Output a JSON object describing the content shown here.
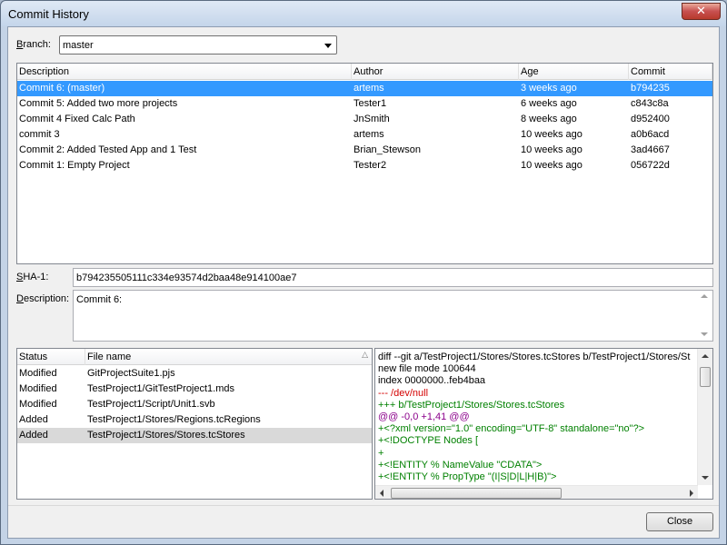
{
  "window": {
    "title": "Commit History",
    "close_glyph": "✕"
  },
  "branch": {
    "label_prefix": "",
    "label_accel": "B",
    "label_rest": "ranch:",
    "value": "master"
  },
  "commits": {
    "columns": [
      "Description",
      "Author",
      "Age",
      "Commit"
    ],
    "rows": [
      {
        "description": "Commit 6:  (master)",
        "author": "artems",
        "age": "3 weeks ago",
        "commit": "b794235"
      },
      {
        "description": "Commit 5: Added two more projects",
        "author": "Tester1",
        "age": "6 weeks ago",
        "commit": "c843c8a"
      },
      {
        "description": "Commit 4 Fixed Calc Path",
        "author": "JnSmith",
        "age": "8 weeks ago",
        "commit": "d952400"
      },
      {
        "description": "commit 3",
        "author": "artems",
        "age": "10 weeks ago",
        "commit": "a0b6acd"
      },
      {
        "description": "Commit 2: Added Tested App and 1 Test",
        "author": "Brian_Stewson",
        "age": "10 weeks ago",
        "commit": "3ad4667"
      },
      {
        "description": "Commit 1: Empty Project",
        "author": "Tester2",
        "age": "10 weeks ago",
        "commit": "056722d"
      }
    ]
  },
  "sha": {
    "label_accel": "S",
    "label_rest": "HA-1:",
    "value": "b794235505111c334e93574d2baa48e914100ae7"
  },
  "description": {
    "label_accel": "D",
    "label_rest": "escription:",
    "value": "Commit 6:"
  },
  "files": {
    "columns": [
      "Status",
      "File name"
    ],
    "sort_glyph": "△",
    "rows": [
      {
        "status": "Modified",
        "name": "GitProjectSuite1.pjs"
      },
      {
        "status": "Modified",
        "name": "TestProject1/GitTestProject1.mds"
      },
      {
        "status": "Modified",
        "name": "TestProject1/Script/Unit1.svb"
      },
      {
        "status": "Added",
        "name": "TestProject1/Stores/Regions.tcRegions"
      },
      {
        "status": "Added",
        "name": "TestProject1/Stores/Stores.tcStores"
      }
    ]
  },
  "diff": {
    "lines": [
      {
        "text": "diff --git a/TestProject1/Stores/Stores.tcStores b/TestProject1/Stores/St",
        "color": "#000000"
      },
      {
        "text": "new file mode 100644",
        "color": "#000000"
      },
      {
        "text": "index 0000000..feb4baa",
        "color": "#000000"
      },
      {
        "text": "--- /dev/null",
        "color": "#d40000"
      },
      {
        "text": "+++ b/TestProject1/Stores/Stores.tcStores",
        "color": "#008000"
      },
      {
        "text": "@@ -0,0 +1,41 @@",
        "color": "#8b008b"
      },
      {
        "text": "+<?xml version=\"1.0\" encoding=\"UTF-8\" standalone=\"no\"?>",
        "color": "#008000"
      },
      {
        "text": "+<!DOCTYPE Nodes [",
        "color": "#008000"
      },
      {
        "text": "+",
        "color": "#008000"
      },
      {
        "text": "+<!ENTITY % NameValue \"CDATA\">",
        "color": "#008000"
      },
      {
        "text": "+<!ENTITY % PropType \"(I|S|D|L|H|B)\">",
        "color": "#008000"
      }
    ]
  },
  "buttons": {
    "close": "Close"
  },
  "colors": {
    "selection": "#3399ff",
    "accent_titlebar": "#c4d5ea"
  }
}
